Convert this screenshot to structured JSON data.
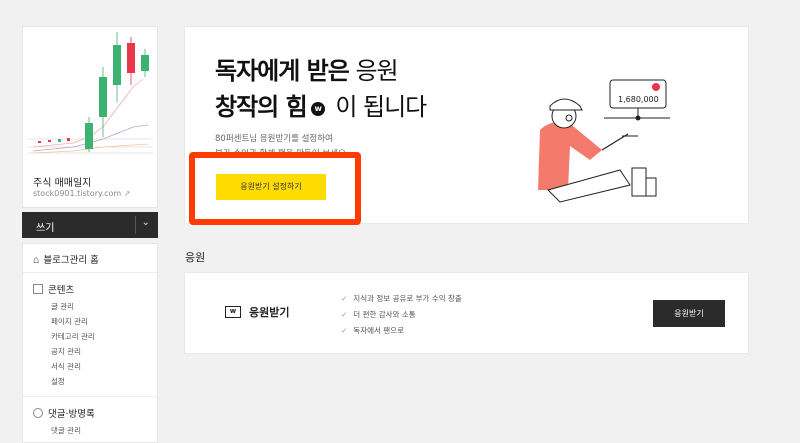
{
  "sidebar": {
    "blog_name": "주식 매매일지",
    "blog_url": "stock0901.tistory.com",
    "write_label": "쓰기",
    "home_label": "블로그관리 홈",
    "contents": {
      "title": "콘텐츠",
      "items": [
        "글 관리",
        "페이지 관리",
        "카테고리 관리",
        "공지 관리",
        "서식 관리",
        "설정"
      ]
    },
    "comments": {
      "title": "댓글·방명록",
      "items": [
        "댓글 관리"
      ]
    }
  },
  "hero": {
    "title_line1_bold": "독자에게 받은",
    "title_line1_light": " 응원",
    "title_line2_bold": "창작의 힘",
    "title_line2_light": " 이 됩니다",
    "badge": "w",
    "desc_line1": "80퍼센트님 응원받기를 설정하여",
    "desc_line2": "부가 수익과 함께 팬을 만들어 보세요",
    "button_label": "응원받기 설정하기",
    "amount": "1,680,000"
  },
  "section": {
    "title": "응원",
    "card_title": "응원받기",
    "icon_letter": "w",
    "features": [
      "지식과 정보 공유로 부가 수익 창출",
      "더 편한 감사와 소통",
      "독자에서 팬으로"
    ],
    "button_label": "응원받기"
  },
  "colors": {
    "accent_yellow": "#ffdc00",
    "highlight_red": "#ff3b00",
    "candle_green": "#3cb371",
    "candle_red": "#e8374a",
    "person_pink": "#f47a6e"
  }
}
